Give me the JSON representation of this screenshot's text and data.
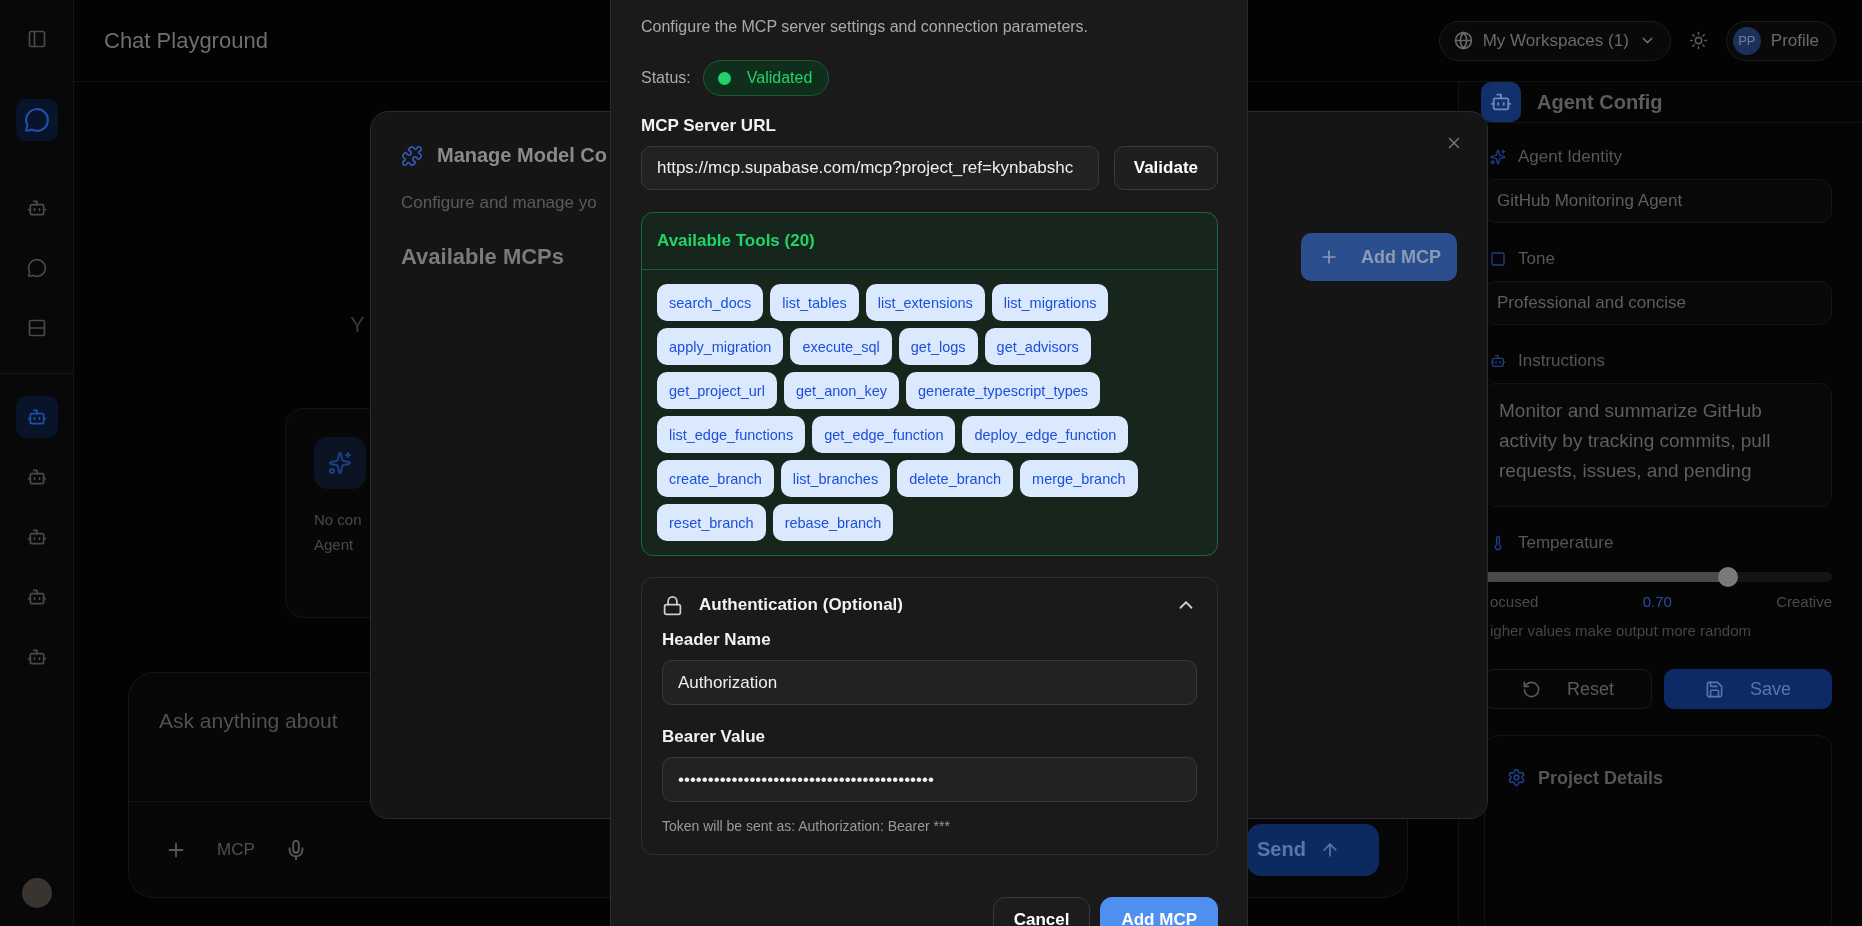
{
  "sidebar": {
    "nav": [
      {
        "selected": true
      },
      {
        "selected": false
      },
      {
        "selected": false
      },
      {
        "selected": false
      }
    ],
    "agents": [
      {
        "selected": true
      },
      {
        "selected": false
      },
      {
        "selected": false
      },
      {
        "selected": false
      },
      {
        "selected": false
      }
    ]
  },
  "header": {
    "title": "Chat Playground",
    "workspace": "My Workspaces (1)",
    "avatar": "PP",
    "profile": "Profile"
  },
  "chat": {
    "heading": "Y",
    "card_lines": [
      "No con",
      "Agent"
    ],
    "placeholder": "Ask anything about",
    "mcp": "MCP",
    "send": "Send"
  },
  "agent_config": {
    "title": "Agent Config",
    "identity_label": "Agent Identity",
    "identity": "GitHub Monitoring Agent",
    "tone_label": "Tone",
    "tone": "Professional and concise",
    "instructions_label": "Instructions",
    "instructions": "Monitor and summarize GitHub activity by tracking commits, pull requests, issues, and pending",
    "temperature": {
      "label": "Temperature",
      "level": 0.7,
      "reading": "0.70",
      "min_label": "ocused",
      "max_label": "Creative",
      "hint": "igher values make output more random"
    },
    "reset": "Reset",
    "save": "Save",
    "project_details": "Project Details"
  },
  "manage_modal": {
    "title": "Manage Model Co",
    "subtitle": "Configure and manage yo",
    "section": "Available MCPs",
    "add_button": "Add MCP"
  },
  "mcp_dialog": {
    "subtitle": "Configure the MCP server settings and connection parameters.",
    "status_label": "Status:",
    "status": "Validated",
    "validated": true,
    "url_label": "MCP Server URL",
    "url": "https://mcp.supabase.com/mcp?project_ref=kynbabshc",
    "validate": "Validate",
    "tools_title": "Available Tools (20)",
    "tools": [
      "search_docs",
      "list_tables",
      "list_extensions",
      "list_migrations",
      "apply_migration",
      "execute_sql",
      "get_logs",
      "get_advisors",
      "get_project_url",
      "get_anon_key",
      "generate_typescript_types",
      "list_edge_functions",
      "get_edge_function",
      "deploy_edge_function",
      "create_branch",
      "list_branches",
      "delete_branch",
      "merge_branch",
      "reset_branch",
      "rebase_branch"
    ],
    "auth": {
      "title": "Authentication (Optional)",
      "expanded": true,
      "header_label": "Header Name",
      "header_value": "Authorization",
      "bearer_label": "Bearer Value",
      "bearer_value": "•••••••••••••••••••••••••••••••••••••••••••",
      "hint": "Token will be sent as: Authorization: Bearer ***"
    },
    "cancel": "Cancel",
    "submit": "Add MCP"
  }
}
